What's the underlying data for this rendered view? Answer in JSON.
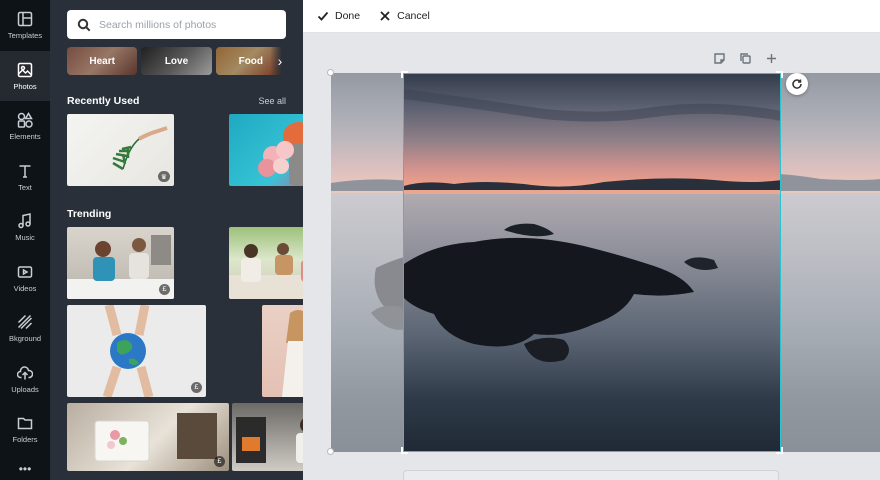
{
  "sidebar": {
    "items": [
      {
        "label": "Templates",
        "icon": "templates-icon"
      },
      {
        "label": "Photos",
        "icon": "photos-icon",
        "active": true
      },
      {
        "label": "Elements",
        "icon": "elements-icon"
      },
      {
        "label": "Text",
        "icon": "text-icon"
      },
      {
        "label": "Music",
        "icon": "music-icon"
      },
      {
        "label": "Videos",
        "icon": "videos-icon"
      },
      {
        "label": "Bkground",
        "icon": "background-icon"
      },
      {
        "label": "Uploads",
        "icon": "uploads-icon"
      },
      {
        "label": "Folders",
        "icon": "folders-icon"
      }
    ],
    "more": "•••"
  },
  "panel": {
    "search_placeholder": "Search millions of photos",
    "chips": [
      "Heart",
      "Love",
      "Food"
    ],
    "recently_used": {
      "title": "Recently Used",
      "see_all": "See all"
    },
    "trending": {
      "title": "Trending"
    },
    "badges": {
      "crown": "♛",
      "pound": "£"
    }
  },
  "toolbar": {
    "done_label": "Done",
    "cancel_label": "Cancel"
  },
  "colors": {
    "rail_bg": "#0e1318",
    "panel_bg": "#293039",
    "crop_border": "#2ec2cf"
  }
}
